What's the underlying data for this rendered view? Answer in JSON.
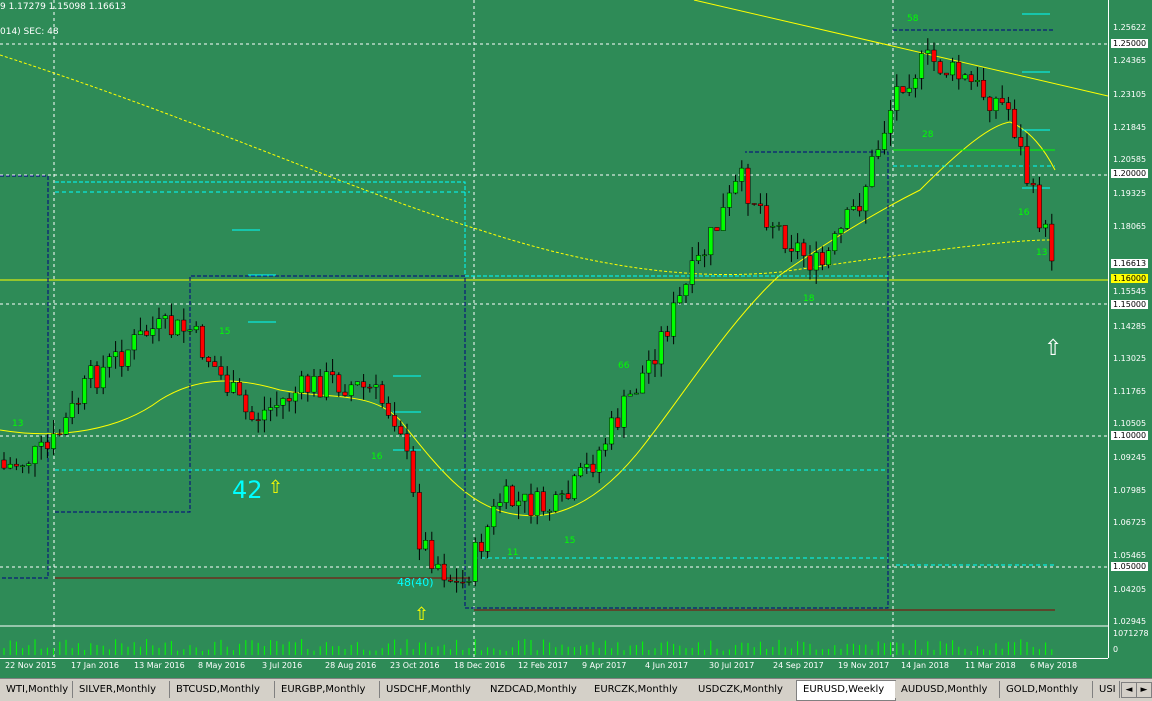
{
  "header": {
    "ohlc_text": "9 1.17279 1.15098 1.16613",
    "indicator_text": "014)  SEC: 48"
  },
  "price_axis": {
    "labels": [
      "1.25622",
      "1.24365",
      "1.23105",
      "1.21845",
      "1.20585",
      "1.19325",
      "1.18065",
      "1.14285",
      "1.13025",
      "1.11765",
      "1.10505",
      "1.09245",
      "1.07985",
      "1.06725",
      "1.05465",
      "1.04205",
      "1.02945",
      "1071278",
      "0"
    ],
    "levels": [
      {
        "label": "1.25000",
        "color": "#ffffff",
        "text": "#000000"
      },
      {
        "label": "1.20000",
        "color": "#ffffff",
        "text": "#000000"
      },
      {
        "label": "1.16613",
        "color": "#ffffff",
        "text": "#000000"
      },
      {
        "label": "1.16000",
        "color": "#ffff00",
        "text": "#000000"
      },
      {
        "label": "1.15545",
        "color": "#2e8b57",
        "text": "#ffffff"
      },
      {
        "label": "1.15000",
        "color": "#ffffff",
        "text": "#000000"
      },
      {
        "label": "1.10000",
        "color": "#ffffff",
        "text": "#000000"
      },
      {
        "label": "1.05000",
        "color": "#ffffff",
        "text": "#000000"
      }
    ]
  },
  "time_axis": {
    "labels": [
      "22 Nov 2015",
      "17 Jan 2016",
      "13 Mar 2016",
      "8 May 2016",
      "3 Jul 2016",
      "28 Aug 2016",
      "23 Oct 2016",
      "18 Dec 2016",
      "12 Feb 2017",
      "9 Apr 2017",
      "4 Jun 2017",
      "30 Jul 2017",
      "24 Sep 2017",
      "19 Nov 2017",
      "14 Jan 2018",
      "11 Mar 2018",
      "6 May 2018"
    ]
  },
  "annotations": {
    "big_count": "42",
    "count_label": "48(40)",
    "small": [
      "58",
      "28",
      "13",
      "15",
      "16",
      "66",
      "11",
      "15",
      "18",
      "16",
      "13"
    ]
  },
  "tabs": [
    {
      "label": "WTI,Monthly"
    },
    {
      "label": "SILVER,Monthly"
    },
    {
      "label": "BTCUSD,Monthly"
    },
    {
      "label": "EURGBP,Monthly"
    },
    {
      "label": "USDCHF,Monthly"
    },
    {
      "label": "NZDCAD,Monthly"
    },
    {
      "label": "EURCZK,Monthly"
    },
    {
      "label": "USDCZK,Monthly"
    },
    {
      "label": "EURUSD,Weekly"
    },
    {
      "label": "AUDUSD,Monthly"
    },
    {
      "label": "GOLD,Monthly"
    },
    {
      "label": "USI"
    }
  ],
  "active_tab": "EURUSD,Weekly",
  "scroll": {
    "left": "◄",
    "right": "►"
  },
  "colors": {
    "background": "#2e8b57",
    "bull": "#00ff00",
    "bear": "#ff0000",
    "grid": "#ffffff",
    "ma": "#ffff00",
    "trend": "#ffff00",
    "channel": "#000080",
    "cyan": "#00ffff"
  }
}
